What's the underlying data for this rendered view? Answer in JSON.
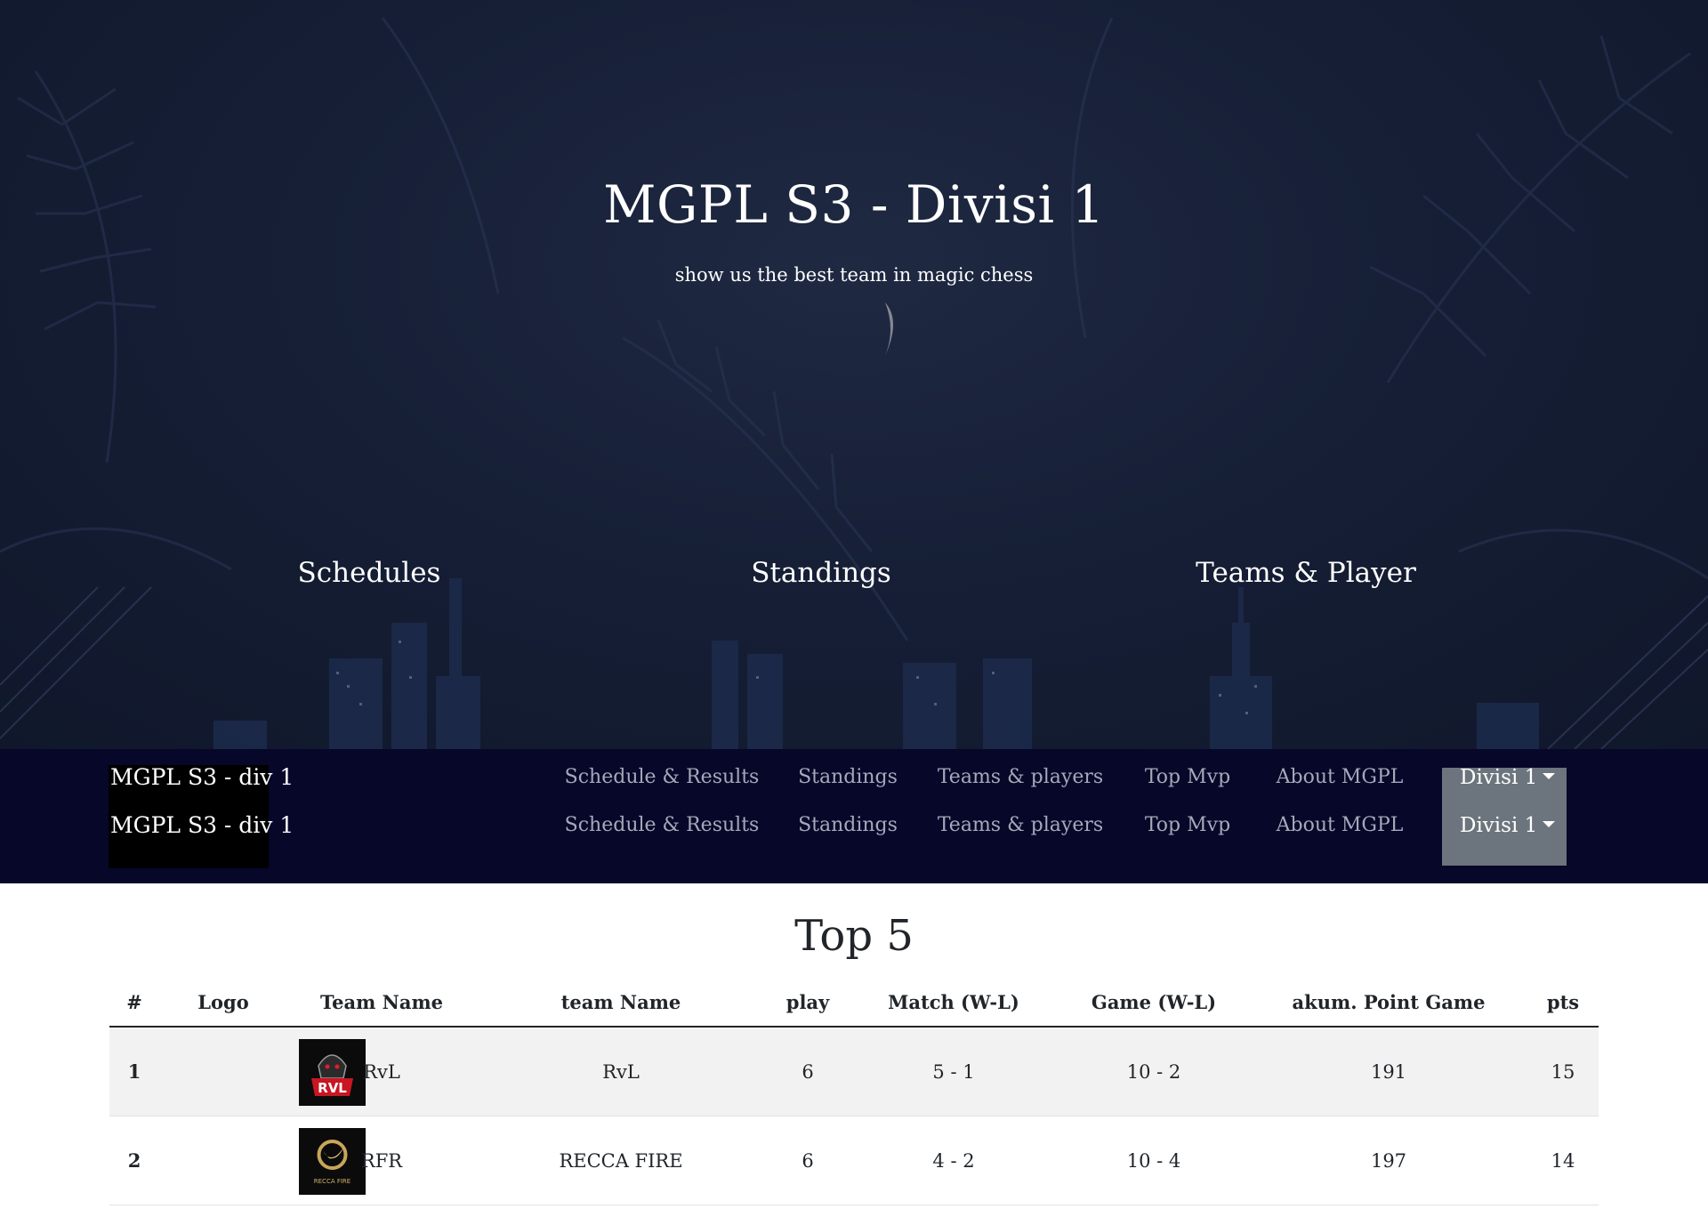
{
  "hero": {
    "title": "MGPL S3 - Divisi 1",
    "subtitle": "show us the best team in magic chess",
    "links": [
      "Schedules",
      "Standings",
      "Teams & Player"
    ]
  },
  "navbar": {
    "brand": "MGPL S3 - div 1",
    "links": [
      "Schedule & Results",
      "Standings",
      "Teams & players",
      "Top Mvp",
      "About MGPL"
    ],
    "dropdown_label": "Divisi 1",
    "colors": {
      "background": "#07072a",
      "link": "#a6a8b8",
      "dropdown": "#6c757d"
    }
  },
  "top5": {
    "title": "Top 5",
    "columns": [
      "#",
      "Logo",
      "Team Name",
      "team Name",
      "play",
      "Match (W-L)",
      "Game (W-L)",
      "akum. Point Game",
      "pts"
    ],
    "rows": [
      {
        "rank": "1",
        "logo_icon": "rvl-team-logo",
        "logo_text": "RVL",
        "team_short": "RvL",
        "team_name": "RvL",
        "play": "6",
        "match": "5 - 1",
        "game": "10 - 2",
        "akum_point": "191",
        "pts": "15"
      },
      {
        "rank": "2",
        "logo_icon": "recca-fire-team-logo",
        "logo_text": "RECCA FIRE",
        "team_short": "RFR",
        "team_name": "RECCA FIRE",
        "play": "6",
        "match": "4 - 2",
        "game": "10 - 4",
        "akum_point": "197",
        "pts": "14"
      }
    ]
  }
}
